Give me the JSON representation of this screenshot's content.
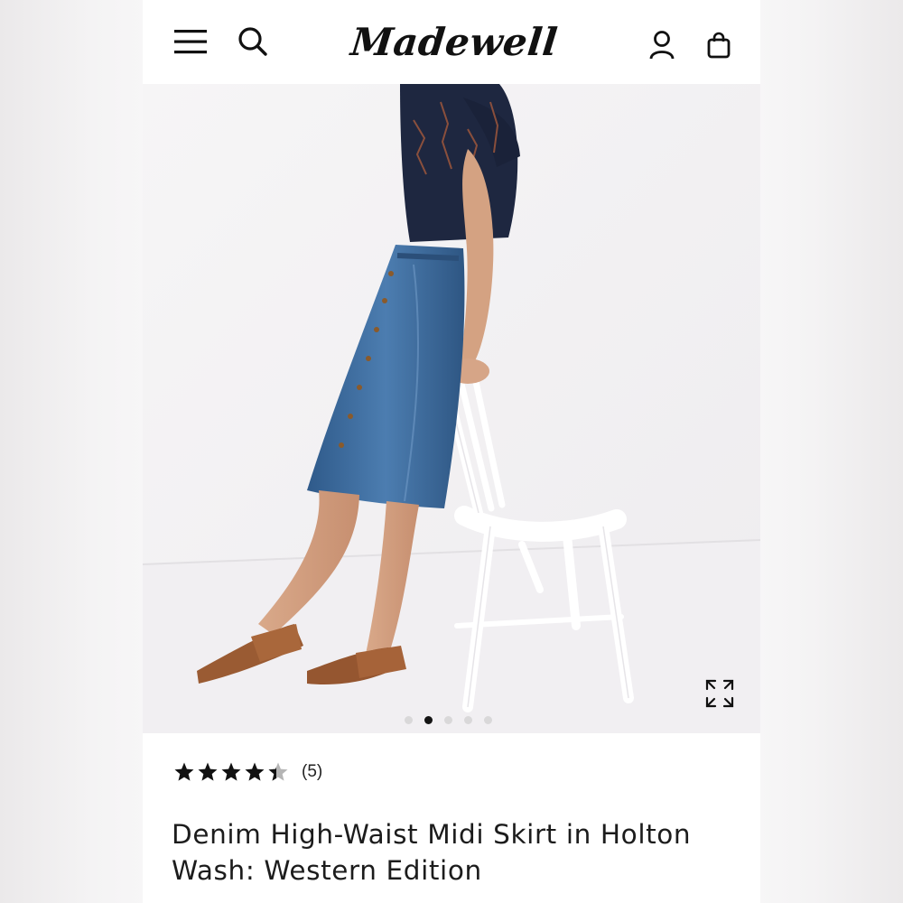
{
  "header": {
    "logo_text": "Madewell",
    "icons": [
      "menu-icon",
      "search-icon",
      "account-icon",
      "bag-icon"
    ]
  },
  "gallery": {
    "image_alt": "Model wearing denim high-waist midi skirt leaning on white chair",
    "slide_count": 5,
    "active_slide": 2,
    "expand_icon": "expand-icon"
  },
  "product": {
    "rating_value": 4.5,
    "rating_max": 5,
    "review_count": "(5)",
    "title": "Denim High-Waist Midi Skirt in Holton Wash: Western Edition"
  },
  "colors": {
    "star_fill": "#111111",
    "star_empty": "#b5b5b5",
    "dot_active": "#141414",
    "dot_inactive": "#d9d8d9"
  }
}
